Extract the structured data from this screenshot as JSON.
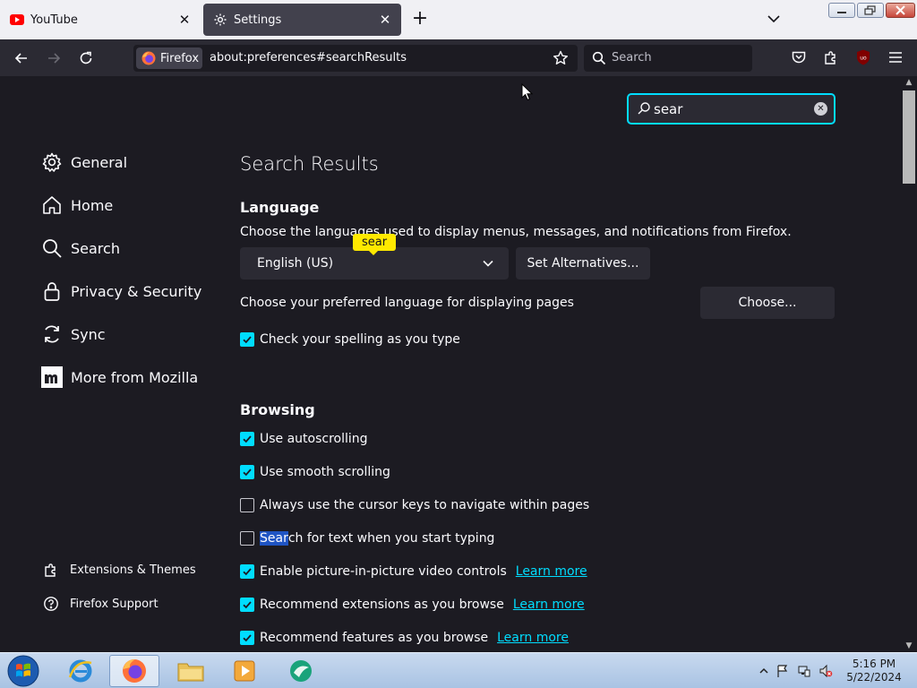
{
  "tabs": [
    {
      "title": "YouTube",
      "active": false
    },
    {
      "title": "Settings",
      "active": true
    }
  ],
  "navbar": {
    "identity_label": "Firefox",
    "url": "about:preferences#searchResults",
    "search_placeholder": "Search"
  },
  "find": {
    "value": "sear"
  },
  "sidebar": {
    "categories": [
      {
        "label": "General",
        "icon": "gear-icon"
      },
      {
        "label": "Home",
        "icon": "home-icon"
      },
      {
        "label": "Search",
        "icon": "search-icon"
      },
      {
        "label": "Privacy & Security",
        "icon": "lock-icon"
      },
      {
        "label": "Sync",
        "icon": "sync-icon"
      },
      {
        "label": "More from Mozilla",
        "icon": "mozilla-icon"
      }
    ],
    "footer": [
      {
        "label": "Extensions & Themes",
        "icon": "puzzle-icon"
      },
      {
        "label": "Firefox Support",
        "icon": "help-icon"
      }
    ]
  },
  "main": {
    "heading": "Search Results",
    "language": {
      "title": "Language",
      "description": "Choose the languages used to display menus, messages, and notifications from Firefox.",
      "selected_language": "English (US)",
      "set_alternatives_label": "Set Alternatives...",
      "badge": "sear",
      "page_language_text": "Choose your preferred language for displaying pages",
      "choose_label": "Choose...",
      "spellcheck": {
        "label": "Check your spelling as you type",
        "checked": true
      }
    },
    "browsing": {
      "title": "Browsing",
      "options": [
        {
          "label": "Use autoscrolling",
          "checked": true
        },
        {
          "label": "Use smooth scrolling",
          "checked": true
        },
        {
          "label": "Always use the cursor keys to navigate within pages",
          "checked": false
        },
        {
          "label_highlight": "Sear",
          "label_rest": "ch for text when you start typing",
          "checked": false
        },
        {
          "label": "Enable picture-in-picture video controls",
          "checked": true,
          "link": "Learn more"
        },
        {
          "label": "Recommend extensions as you browse",
          "checked": true,
          "link": "Learn more"
        },
        {
          "label": "Recommend features as you browse",
          "checked": true,
          "link": "Learn more"
        }
      ]
    }
  },
  "taskbar": {
    "time": "5:16 PM",
    "date": "5/22/2024"
  },
  "colors": {
    "accent": "#00ddff",
    "page_bg": "#1c1b22",
    "toolbar_bg": "#2b2a33",
    "find_highlight": "#ffe900"
  }
}
